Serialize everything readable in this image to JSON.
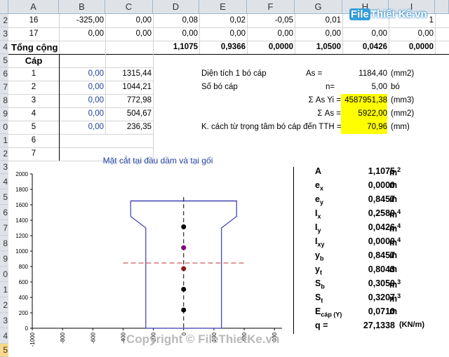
{
  "columns": [
    "A",
    "B",
    "C",
    "D",
    "E",
    "F",
    "G",
    "H",
    "I"
  ],
  "rows_numbers": [
    "2",
    "3",
    "4",
    "5",
    "6",
    "7",
    "8",
    "9",
    "0",
    "1",
    "2",
    "3",
    "4",
    "5",
    "6",
    "7",
    "8",
    "9",
    "0",
    "1",
    "2",
    "3",
    "4",
    "5",
    "6"
  ],
  "top_rows": [
    {
      "a": "16",
      "b": "-325,00",
      "c": "0,00",
      "d": "0,08",
      "e": "0,02",
      "f": "-0,05",
      "g": "0,01",
      "h": "",
      "i": "1"
    },
    {
      "a": "17",
      "b": "0,00",
      "c": "0,00",
      "d": "0,00",
      "e": "0,00",
      "f": "0,00",
      "g": "0,00",
      "h": "0,00",
      "i": "0,00"
    }
  ],
  "total_row": {
    "label": "Tổng cộng",
    "d": "1,1075",
    "e": "0,9366",
    "f": "0,0000",
    "g": "1,0500",
    "h": "0,0426",
    "i": "0,0000"
  },
  "cap_header": "Cáp",
  "cap_rows": [
    {
      "n": "1",
      "b": "0,00",
      "c": "1315,44"
    },
    {
      "n": "2",
      "b": "0,00",
      "c": "1044,21"
    },
    {
      "n": "3",
      "b": "0,00",
      "c": "772,98"
    },
    {
      "n": "4",
      "b": "0,00",
      "c": "504,67"
    },
    {
      "n": "5",
      "b": "0,00",
      "c": "236,35"
    },
    {
      "n": "6",
      "b": "",
      "c": ""
    },
    {
      "n": "7",
      "b": "",
      "c": ""
    }
  ],
  "info": [
    {
      "label": "Diện tích 1 bó cáp",
      "key": "As =",
      "value": "1184,40",
      "unit": "(mm2)",
      "highlight": false
    },
    {
      "label": "Số bó cáp",
      "key": "n=",
      "value": "5,00",
      "unit": "bó",
      "highlight": false
    },
    {
      "label": "",
      "key": "Σ As Yi =",
      "value": "4587951,38",
      "unit": "(mm3)",
      "highlight": true
    },
    {
      "label": "",
      "key": "Σ As =",
      "value": "5922,00",
      "unit": "(mm2)",
      "highlight": true
    },
    {
      "label": "K. cách từ trọng tâm bó cáp đến TTH =",
      "key": "",
      "value": "70,96",
      "unit": "(mm)",
      "highlight": true
    }
  ],
  "chart_title": "Mặt cắt tại đầu dầm và tại gối",
  "chart_data": {
    "type": "scatter",
    "title": "Mặt cắt tại đầu dầm và tại gối",
    "x_ticks": [
      "-1000",
      "-800",
      "-600",
      "-400",
      "-200",
      "0",
      "200",
      "400",
      "600"
    ],
    "y_ticks": [
      "0",
      "200",
      "400",
      "600",
      "800",
      "1000",
      "1200",
      "1400",
      "1600",
      "1800",
      "2000"
    ],
    "xlim": [
      -1000,
      650
    ],
    "ylim": [
      0,
      2000
    ],
    "section_outline": [
      [
        -250,
        0
      ],
      [
        250,
        0
      ],
      [
        250,
        1300
      ],
      [
        350,
        1450
      ],
      [
        350,
        1650
      ],
      [
        -350,
        1650
      ],
      [
        -350,
        1450
      ],
      [
        -250,
        1300
      ],
      [
        -250,
        0
      ]
    ],
    "top_flange": [
      [
        -350,
        1650
      ],
      [
        350,
        1650
      ]
    ],
    "cable_points": [
      [
        0,
        236
      ],
      [
        0,
        505
      ],
      [
        0,
        1315
      ]
    ],
    "centroid_point": [
      0,
      1044
    ],
    "cable_centroid_point": [
      0,
      773
    ],
    "neutral_axis_y": 845,
    "neutral_axis_x": [
      -400,
      400
    ],
    "colors": {
      "outline": "#3b3bb0",
      "cable": "#000000",
      "centroid": "#800080",
      "cable_centroid": "#8b1a1a",
      "axis": "#c0303a"
    }
  },
  "properties": [
    {
      "sym": "A",
      "sub": "",
      "val": "1,1075",
      "unit": "m",
      "sup": "2"
    },
    {
      "sym": "e",
      "sub": "x",
      "val": "0,0000",
      "unit": "m",
      "sup": ""
    },
    {
      "sym": "e",
      "sub": "y",
      "val": "0,8457",
      "unit": "m",
      "sup": ""
    },
    {
      "sym": "I",
      "sub": "x",
      "val": "0,2580",
      "unit": "m",
      "sup": "4"
    },
    {
      "sym": "I",
      "sub": "y",
      "val": "0,0426",
      "unit": "m",
      "sup": "4"
    },
    {
      "sym": "I",
      "sub": "xy",
      "val": "0,0000",
      "unit": "m",
      "sup": "4"
    },
    {
      "sym": "y",
      "sub": "b",
      "val": "0,8457",
      "unit": "m",
      "sup": ""
    },
    {
      "sym": "y",
      "sub": "t",
      "val": "0,8043",
      "unit": "m",
      "sup": ""
    },
    {
      "sym": "S",
      "sub": "b",
      "val": "0,3050",
      "unit": "m",
      "sup": "3"
    },
    {
      "sym": "S",
      "sub": "t",
      "val": "0,3207",
      "unit": "m",
      "sup": "3"
    },
    {
      "sym": "E",
      "sub": "cáp (Y)",
      "val": "0,0710",
      "unit": "m",
      "sup": ""
    },
    {
      "sym": "q =",
      "sub": "",
      "val": "27,1338",
      "unit": "(KN/m)",
      "sup": ""
    }
  ],
  "watermark": "Copyright © FileThietKe.vn",
  "logo": {
    "prefix": "File",
    "rest": "Thiết Kế.vn"
  }
}
